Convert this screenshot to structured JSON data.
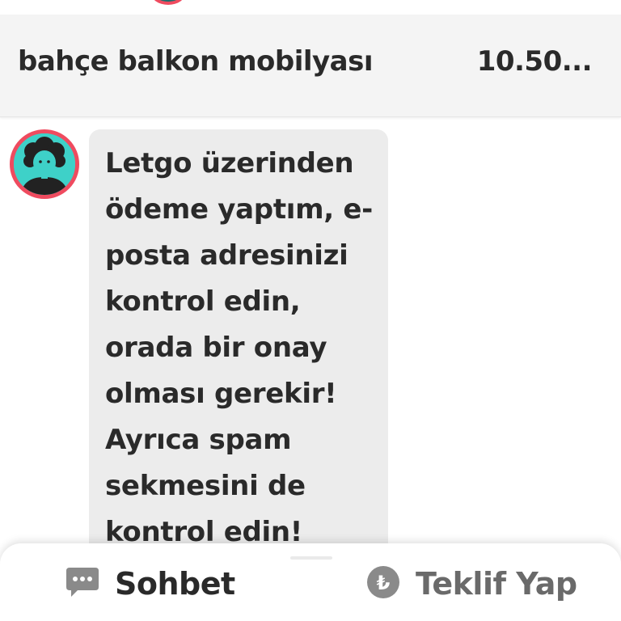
{
  "listing": {
    "title": "bahçe balkon mobilyası",
    "price": "10.50..."
  },
  "message": {
    "text": "Letgo üzerinden\nödeme yaptım, e-\nposta adresinizi\nkontrol edin,\norada bir onay\nolması gerekir!\nAyrıca spam\nsekmesini de\nkontrol edin!"
  },
  "actions": {
    "chat_label": "Sohbet",
    "chat_icon": "chat-bubble-icon",
    "offer_label": "Teklif Yap",
    "offer_icon": "lira-coin-icon"
  },
  "colors": {
    "avatar_ring": "#ef4b5f",
    "avatar_bg": "#3ed1c8",
    "bubble_bg": "#ececec",
    "text": "#2a2a2a",
    "muted_text": "#6a6a6a"
  }
}
